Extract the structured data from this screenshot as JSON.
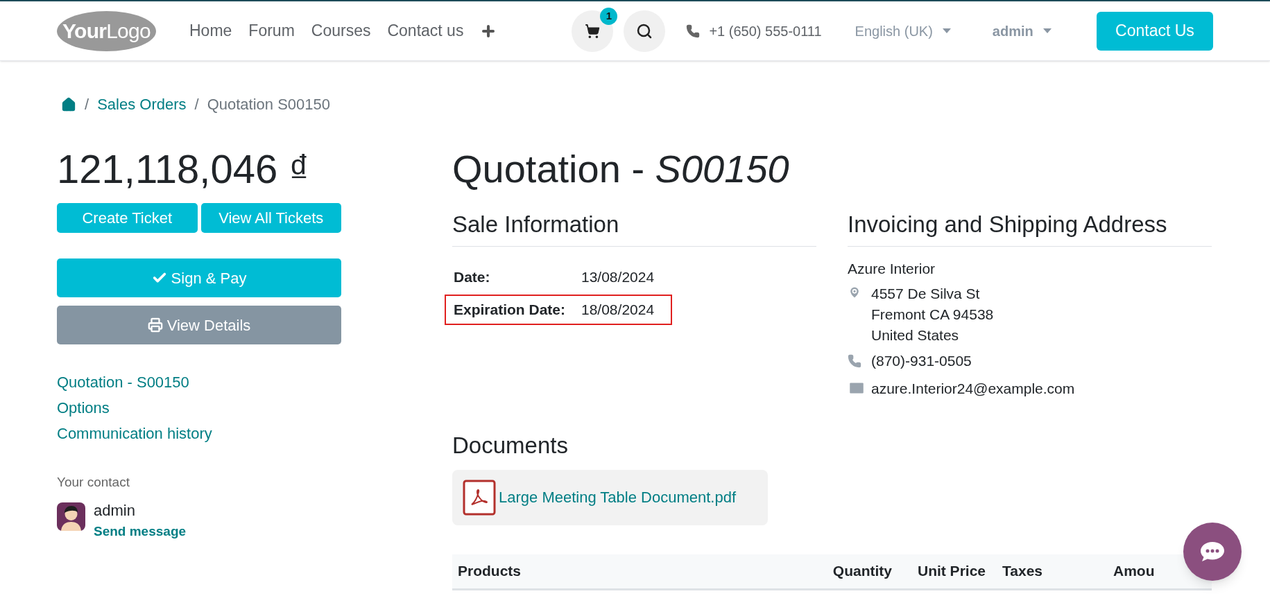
{
  "header": {
    "logo": {
      "bold": "Your",
      "light": "Logo"
    },
    "nav": [
      "Home",
      "Forum",
      "Courses",
      "Contact us"
    ],
    "cart_count": "1",
    "phone": "+1 (650) 555-0111",
    "language": "English (UK)",
    "user": "admin",
    "cta": "Contact Us"
  },
  "breadcrumb": {
    "separator": "/",
    "items": [
      "Sales Orders",
      "Quotation S00150"
    ]
  },
  "sidebar": {
    "amount": "121,118,046 ₫",
    "ticket_buttons": [
      "Create Ticket",
      "View All Tickets"
    ],
    "sign_button": "Sign & Pay",
    "details_button": "View Details",
    "links": [
      "Quotation - S00150",
      "Options",
      "Communication history"
    ],
    "contact_label": "Your contact",
    "contact_name": "admin",
    "contact_action": "Send message"
  },
  "title": "Quotation - *S00150*",
  "sale_info": {
    "heading": "Sale Information",
    "fields": [
      {
        "label": "Date:",
        "value": "13/08/2024",
        "highlighted": false
      },
      {
        "label": "Expiration Date:",
        "value": "18/08/2024",
        "highlighted": true
      }
    ]
  },
  "address": {
    "heading": "Invoicing and Shipping Address",
    "name": "Azure Interior",
    "lines": [
      "4557 De Silva St",
      "Fremont CA 94538",
      "United States"
    ],
    "phone": "(870)-931-0505",
    "email": "azure.Interior24@example.com"
  },
  "documents": {
    "heading": "Documents",
    "files": [
      {
        "name": "Large Meeting Table Document.pdf"
      }
    ]
  },
  "table": {
    "columns": [
      "Products",
      "Quantity",
      "Unit Price",
      "Taxes",
      "Amou"
    ]
  }
}
